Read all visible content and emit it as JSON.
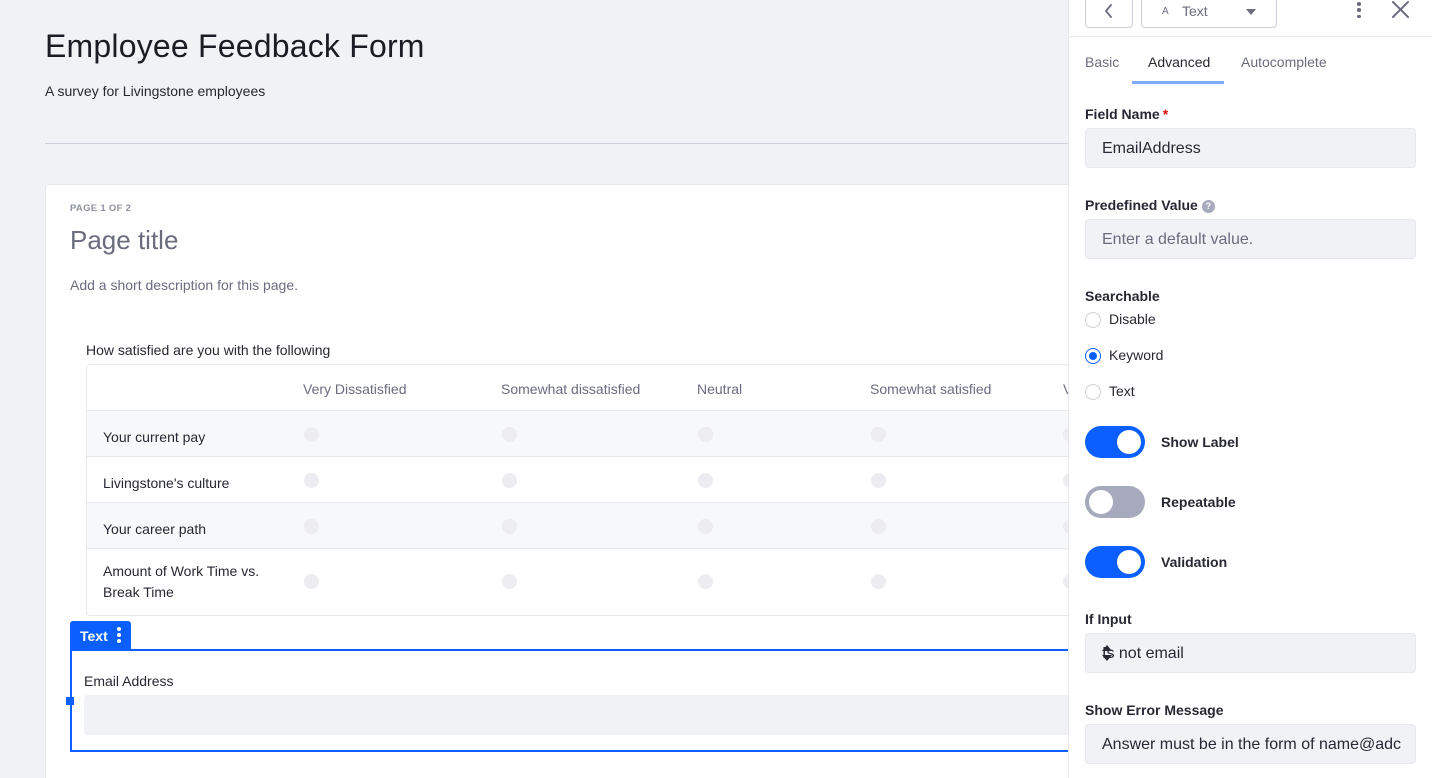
{
  "form": {
    "title": "Employee Feedback Form",
    "description": "A survey for Livingstone employees"
  },
  "page": {
    "counter": "PAGE 1 OF 2",
    "title_placeholder": "Page title",
    "description_placeholder": "Add a short description for this page."
  },
  "grid": {
    "label": "How satisfied are you with the following",
    "columns": [
      "Very Dissatisfied",
      "Somewhat dissatisfied",
      "Neutral",
      "Somewhat satisfied",
      "V"
    ],
    "rows": [
      "Your current pay",
      "Livingstone's culture",
      "Your career path",
      "Amount of Work Time vs. Break Time"
    ]
  },
  "selected_field": {
    "tag": "Text",
    "label": "Email Address"
  },
  "sidebar": {
    "field_type": "Text",
    "field_type_icon": "A",
    "tabs": [
      "Basic",
      "Advanced",
      "Autocomplete"
    ],
    "active_tab": "Advanced",
    "field_name": {
      "label": "Field Name",
      "required_mark": "*",
      "value": "EmailAddress"
    },
    "predefined_value": {
      "label": "Predefined Value",
      "help": "?",
      "placeholder": "Enter a default value."
    },
    "searchable": {
      "label": "Searchable",
      "options": [
        "Disable",
        "Keyword",
        "Text"
      ],
      "selected": "Keyword"
    },
    "toggles": {
      "show_label": {
        "label": "Show Label",
        "on": true
      },
      "repeatable": {
        "label": "Repeatable",
        "on": false
      },
      "validation": {
        "label": "Validation",
        "on": true
      }
    },
    "if_input": {
      "label": "If Input",
      "value": "Is not email"
    },
    "error_message": {
      "label": "Show Error Message",
      "value": "Answer must be in the form of name@adc"
    }
  },
  "colors": {
    "primary": "#0b5fff",
    "toggle_off": "#a7a9bc",
    "tab_indicator": "#80acff",
    "required": "#da1414"
  }
}
